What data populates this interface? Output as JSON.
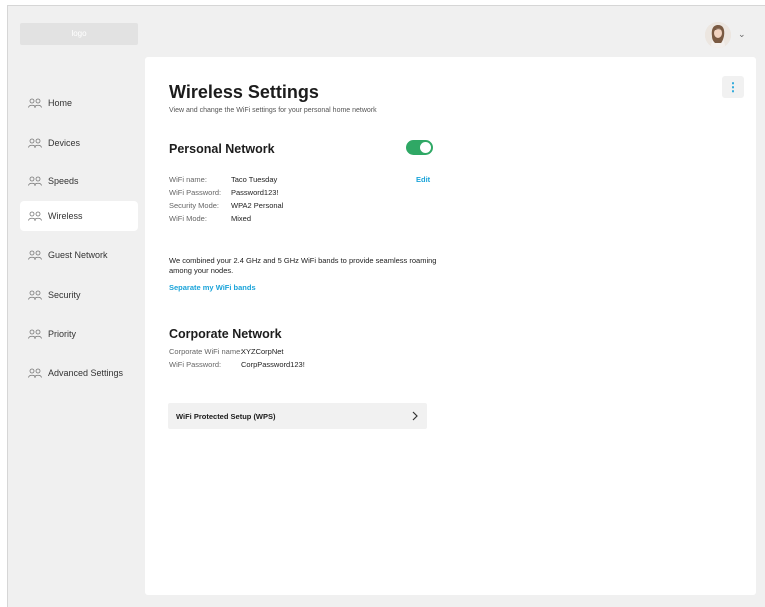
{
  "header": {
    "logo_text": "logo",
    "avatar_caret": "⌄"
  },
  "sidebar": {
    "items": [
      {
        "label": "Home",
        "icon": "people-icon",
        "active": false
      },
      {
        "label": "Devices",
        "icon": "people-icon",
        "active": false
      },
      {
        "label": "Speeds",
        "icon": "people-icon",
        "active": false
      },
      {
        "label": "Wireless",
        "icon": "people-icon",
        "active": true
      },
      {
        "label": "Guest Network",
        "icon": "people-icon",
        "active": false
      },
      {
        "label": "Security",
        "icon": "people-icon",
        "active": false
      },
      {
        "label": "Priority",
        "icon": "people-icon",
        "active": false
      },
      {
        "label": "Advanced Settings",
        "icon": "people-icon",
        "active": false
      }
    ]
  },
  "main": {
    "title": "Wireless Settings",
    "subtitle": "View and change the WiFi settings for your personal home network",
    "more_icon": "⋮",
    "personal": {
      "title": "Personal Network",
      "toggle_on": true,
      "edit_label": "Edit",
      "fields": [
        {
          "label": "WiFi name:",
          "value": "Taco Tuesday"
        },
        {
          "label": "WiFi Password:",
          "value": "Password123!"
        },
        {
          "label": "Security Mode:",
          "value": "WPA2 Personal"
        },
        {
          "label": "WiFi Mode:",
          "value": "Mixed"
        }
      ],
      "band_note": "We combined your 2.4 GHz and 5 GHz WiFi bands to provide seamless roaming among your nodes.",
      "separate_link": "Separate my WiFi bands"
    },
    "corporate": {
      "title": "Corporate Network",
      "fields": [
        {
          "label": "Corporate WiFi name:",
          "value": "XYZCorpNet"
        },
        {
          "label": "WiFi Password:",
          "value": "CorpPassword123!"
        }
      ]
    },
    "wps": {
      "label": "WiFi Protected Setup (WPS)"
    }
  },
  "colors": {
    "accent": "#1aa3d9",
    "toggle_on": "#2fa865",
    "page_bg": "#f0f0f0"
  }
}
